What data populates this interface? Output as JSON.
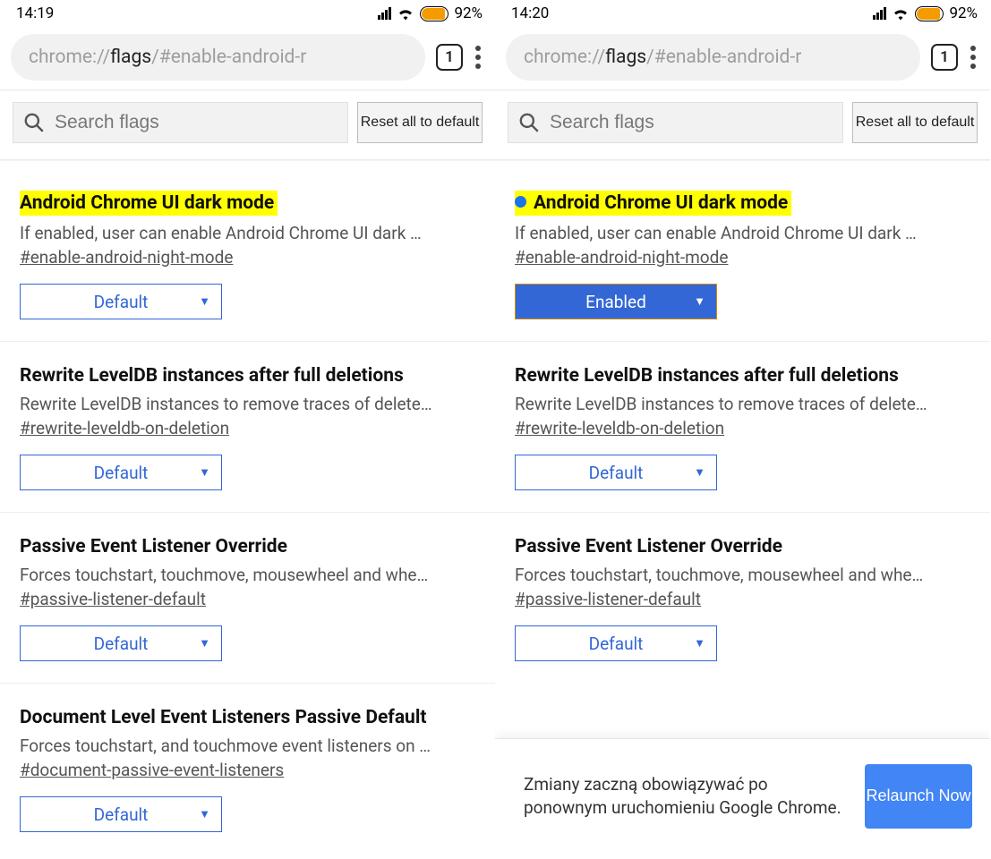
{
  "left": {
    "status": {
      "time": "14:19",
      "battery": "92%"
    },
    "url": {
      "pre": "chrome://",
      "strong": "flags",
      "post": "/#enable-android-r"
    },
    "tab_count": "1",
    "search": {
      "placeholder": "Search flags"
    },
    "reset_label": "Reset all to default",
    "flags": [
      {
        "title": "Android Chrome UI dark mode",
        "highlighted": true,
        "dot": false,
        "desc": "If enabled, user can enable Android Chrome UI dark …",
        "hash": "#enable-android-night-mode",
        "value": "Default",
        "enabled": false
      },
      {
        "title": "Rewrite LevelDB instances after full deletions",
        "desc": "Rewrite LevelDB instances to remove traces of delete…",
        "hash": "#rewrite-leveldb-on-deletion",
        "value": "Default",
        "enabled": false
      },
      {
        "title": "Passive Event Listener Override",
        "desc": "Forces touchstart, touchmove, mousewheel and whe…",
        "hash": "#passive-listener-default",
        "value": "Default",
        "enabled": false
      },
      {
        "title": "Document Level Event Listeners Passive Default",
        "desc": "Forces touchstart, and touchmove event listeners on …",
        "hash": "#document-passive-event-listeners",
        "value": "Default",
        "enabled": false
      }
    ]
  },
  "right": {
    "status": {
      "time": "14:20",
      "battery": "92%"
    },
    "url": {
      "pre": "chrome://",
      "strong": "flags",
      "post": "/#enable-android-r"
    },
    "tab_count": "1",
    "search": {
      "placeholder": "Search flags"
    },
    "reset_label": "Reset all to default",
    "flags": [
      {
        "title": "Android Chrome UI dark mode",
        "highlighted": true,
        "dot": true,
        "desc": "If enabled, user can enable Android Chrome UI dark …",
        "hash": "#enable-android-night-mode",
        "value": "Enabled",
        "enabled": true
      },
      {
        "title": "Rewrite LevelDB instances after full deletions",
        "desc": "Rewrite LevelDB instances to remove traces of delete…",
        "hash": "#rewrite-leveldb-on-deletion",
        "value": "Default",
        "enabled": false
      },
      {
        "title": "Passive Event Listener Override",
        "desc": "Forces touchstart, touchmove, mousewheel and whe…",
        "hash": "#passive-listener-default",
        "value": "Default",
        "enabled": false
      }
    ],
    "relaunch": {
      "msg": "Zmiany zaczną obowiązywać po ponownym uruchomieniu Google Chrome.",
      "btn": "Relaunch Now"
    }
  }
}
